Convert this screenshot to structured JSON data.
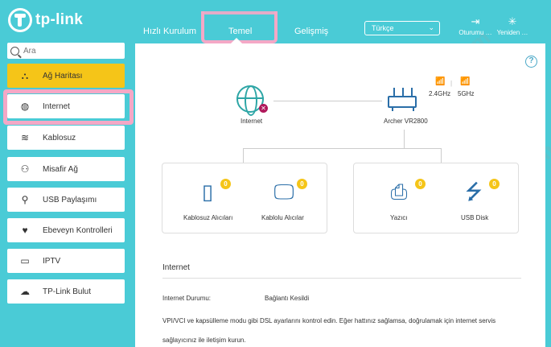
{
  "brand": {
    "logo_text": "tp-link"
  },
  "nav": {
    "tabs": [
      {
        "label": "Hızlı Kurulum"
      },
      {
        "label": "Temel"
      },
      {
        "label": "Gelişmiş"
      }
    ],
    "language": "Türkçe",
    "logout_label": "Oturumu …",
    "reboot_label": "Yeniden …"
  },
  "sidebar": {
    "search_placeholder": "Ara",
    "items": [
      {
        "label": "Ağ Haritası",
        "icon": "network-map-icon"
      },
      {
        "label": "Internet",
        "icon": "globe-icon"
      },
      {
        "label": "Kablosuz",
        "icon": "wireless-icon"
      },
      {
        "label": "Misafir Ağ",
        "icon": "guest-icon"
      },
      {
        "label": "USB Paylaşımı",
        "icon": "usb-icon"
      },
      {
        "label": "Ebeveyn Kontrolleri",
        "icon": "heart-icon"
      },
      {
        "label": "IPTV",
        "icon": "tv-icon"
      },
      {
        "label": "TP-Link Bulut",
        "icon": "cloud-icon"
      }
    ]
  },
  "map": {
    "internet_label": "Internet",
    "router_label": "Archer VR2800",
    "band_24": "2.4GHz",
    "band_5": "5GHz",
    "wireless_clients_label": "Kablosuz Alıcıları",
    "wired_clients_label": "Kablolu Alıcılar",
    "printer_label": "Yazıcı",
    "usb_disk_label": "USB Disk",
    "wireless_count": "0",
    "wired_count": "0",
    "printer_count": "0",
    "usb_count": "0"
  },
  "details": {
    "section_title": "Internet",
    "status_key": "Internet Durumu:",
    "status_value": "Bağlantı Kesildi",
    "description": "VPI/VCI ve kapsülleme modu gibi DSL ayarlarını kontrol edin. Eğer hattınız sağlamsa, doğrulamak için internet servis sağlayıcınız ile iletişim kurun."
  },
  "colors": {
    "accent": "#4acbd6",
    "active": "#f5c518",
    "highlight": "#f4a8c6",
    "error": "#b0185b"
  }
}
